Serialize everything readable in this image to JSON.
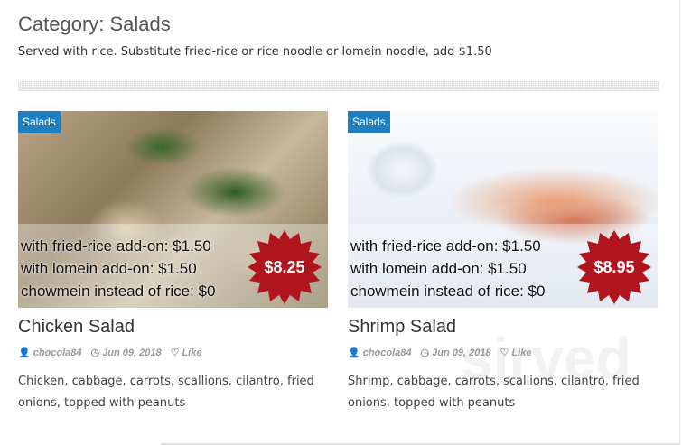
{
  "category": {
    "title": "Category: Salads",
    "description": "Served with rice. Substitute fried-rice or rice noodle or lomein noodle, add $1.50"
  },
  "watermark": "sirved",
  "items": [
    {
      "badge": "Salads",
      "addons": [
        "with fried-rice add-on: $1.50",
        "with lomein add-on: $1.50",
        "chowmein instead of rice: $0"
      ],
      "price": "$8.25",
      "title": "Chicken Salad",
      "author": "chocola84",
      "date": "Jun 09, 2018",
      "like": "Like",
      "description": "Chicken, cabbage, carrots, scallions, cilantro, fried onions, topped with peanuts"
    },
    {
      "badge": "Salads",
      "addons": [
        "with fried-rice add-on: $1.50",
        "with lomein add-on: $1.50",
        "chowmein instead of rice: $0"
      ],
      "price": "$8.95",
      "title": "Shrimp Salad",
      "author": "chocola84",
      "date": "Jun 09, 2018",
      "like": "Like",
      "description": "Shrimp, cabbage, carrots, scallions, cilantro, fried onions, topped with peanuts"
    }
  ],
  "colors": {
    "badge": "#1e7fc1",
    "price_star": "#b0151e"
  }
}
